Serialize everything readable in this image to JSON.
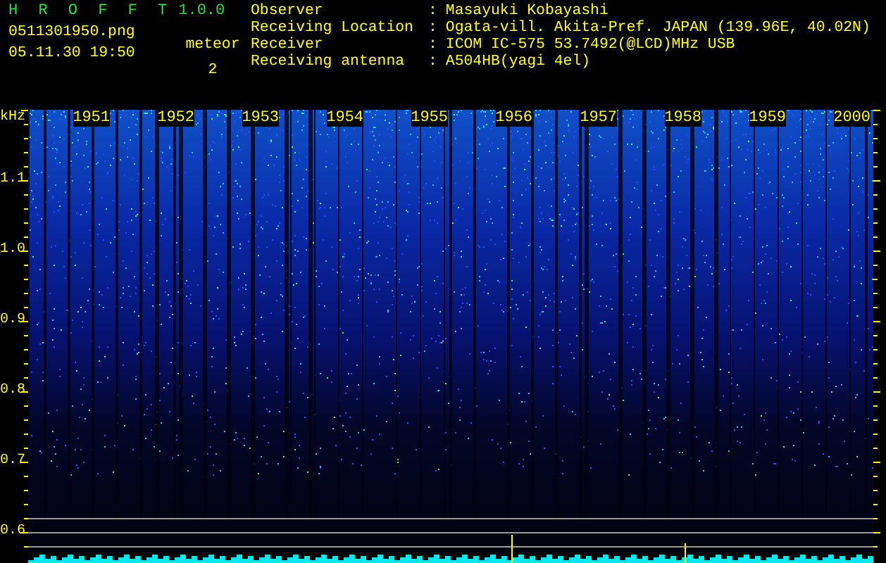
{
  "app": {
    "title": "H R O F F T",
    "version": "1.0.0",
    "file": "0511301950.png",
    "datetime": "05.11.30 19:50",
    "counter_label": "meteor",
    "counter_value": "2"
  },
  "info": [
    {
      "label": "Observer",
      "sep": ":",
      "value": "Masayuki Kobayashi"
    },
    {
      "label": "Receiving Location",
      "sep": ":",
      "value": "Ogata-vill. Akita-Pref. JAPAN (139.96E, 40.02N)"
    },
    {
      "label": "Receiver",
      "sep": ":",
      "value": "ICOM IC-575 53.7492(@LCD)MHz USB"
    },
    {
      "label": "Receiving antenna",
      "sep": ":",
      "value": "A504HB(yagi 4el)"
    }
  ],
  "spectrogram": {
    "y_unit": "kHz",
    "y_labels": [
      "1.1",
      "1.0",
      "0.9",
      "0.8",
      "0.7",
      "0.6"
    ],
    "time_labels": [
      "1951",
      "1952",
      "1953",
      "1954",
      "1955",
      "1956",
      "1957",
      "1958",
      "1959",
      "2000"
    ]
  }
}
